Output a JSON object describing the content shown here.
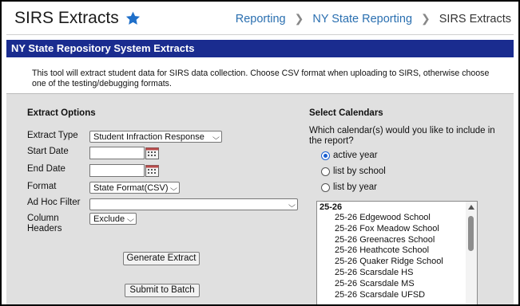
{
  "header": {
    "title": "SIRS Extracts",
    "breadcrumbs": [
      "Reporting",
      "NY State Reporting",
      "SIRS Extracts"
    ]
  },
  "banner": {
    "title": "NY State Repository System Extracts",
    "description": "This tool will extract student data for SIRS data collection. Choose CSV format when uploading to SIRS, otherwise choose one of the testing/debugging formats."
  },
  "extract_options": {
    "heading": "Extract Options",
    "extract_type_label": "Extract Type",
    "extract_type_value": "Student Infraction Response",
    "start_date_label": "Start Date",
    "start_date_value": "",
    "end_date_label": "End Date",
    "end_date_value": "",
    "format_label": "Format",
    "format_value": "State Format(CSV)",
    "adhoc_label": "Ad Hoc Filter",
    "adhoc_value": "",
    "column_headers_label_1": "Column",
    "column_headers_label_2": "Headers",
    "column_headers_value": "Exclude",
    "generate_button": "Generate Extract",
    "batch_button": "Submit to Batch"
  },
  "calendars": {
    "heading": "Select Calendars",
    "question": "Which calendar(s) would you like to include in the report?",
    "options": [
      "active year",
      "list by school",
      "list by year"
    ],
    "selected_option": "active year",
    "group": "25-26",
    "items": [
      "25-26 Edgewood School",
      "25-26 Fox Meadow School",
      "25-26 Greenacres School",
      "25-26 Heathcote School",
      "25-26 Quaker Ridge School",
      "25-26 Scarsdale HS",
      "25-26 Scarsdale MS",
      "25-26 Scarsdale UFSD"
    ]
  },
  "colors": {
    "banner": "#1a2c8f",
    "link": "#2a6fb0",
    "star": "#1f6fc9",
    "panel": "#e0e0e0"
  },
  "icons": [
    "star-icon",
    "chevron-right-icon",
    "calendar-icon",
    "dropdown-arrow-icon",
    "scroll-up-icon"
  ]
}
